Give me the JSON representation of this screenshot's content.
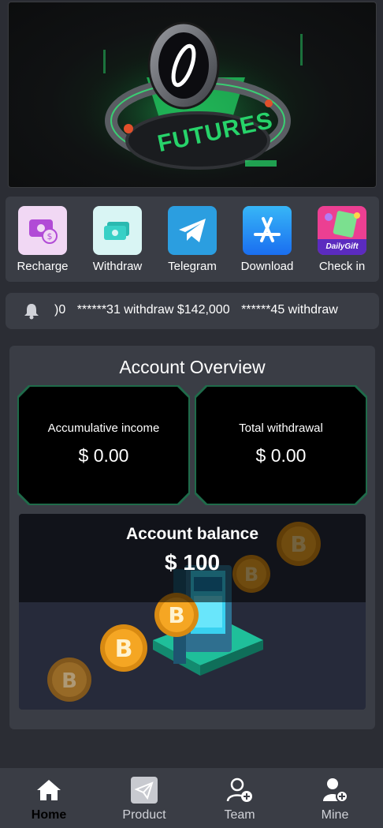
{
  "banner": {
    "text": "FUTURES",
    "accent": "#27d36a"
  },
  "quick_menu": [
    {
      "label": "Recharge",
      "icon": "recharge-icon"
    },
    {
      "label": "Withdraw",
      "icon": "withdraw-icon"
    },
    {
      "label": "Telegram",
      "icon": "telegram-icon"
    },
    {
      "label": "Download",
      "icon": "app-store-icon"
    },
    {
      "label": "Check in",
      "icon": "daily-gift-icon",
      "badge": "DailyGift"
    }
  ],
  "notice": {
    "icon": "bell-icon",
    "items": [
      ")0",
      "******31 withdraw $142,000",
      "******45 withdraw"
    ]
  },
  "overview": {
    "title": "Account Overview",
    "accumulative_label": "Accumulative income",
    "accumulative_value": "$ 0.00",
    "withdrawal_label": "Total withdrawal",
    "withdrawal_value": "$ 0.00",
    "balance_label": "Account balance",
    "balance_value": "$ 100"
  },
  "nav": [
    {
      "label": "Home",
      "icon": "home-icon",
      "active": true
    },
    {
      "label": "Product",
      "icon": "product-icon",
      "active": false
    },
    {
      "label": "Team",
      "icon": "team-icon",
      "active": false
    },
    {
      "label": "Mine",
      "icon": "mine-icon",
      "active": false
    }
  ],
  "colors": {
    "background": "#2b2d34",
    "panel": "#3a3d45",
    "frame_green": "#1f6b4a",
    "coin": "#f5a623"
  }
}
